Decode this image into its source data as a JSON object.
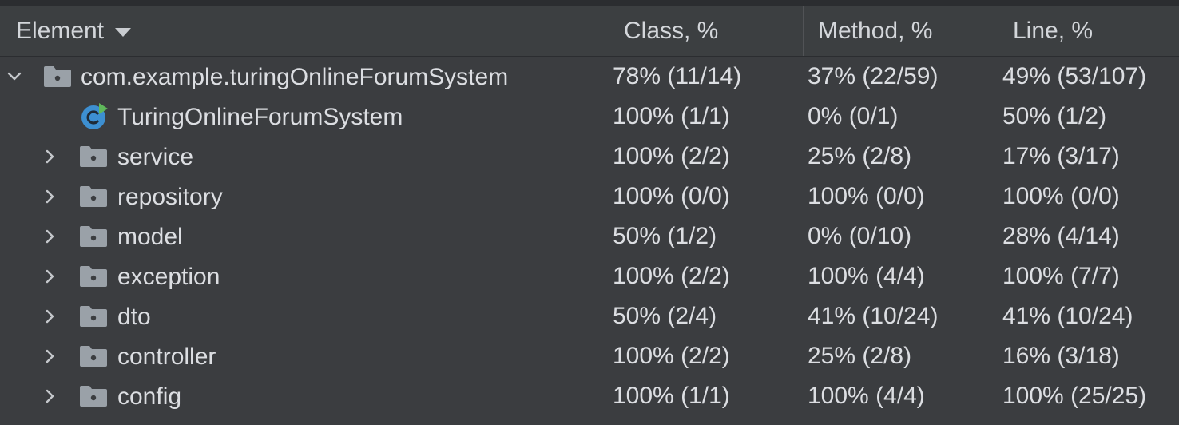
{
  "header": {
    "element": "Element",
    "class": "Class, %",
    "method": "Method, %",
    "line": "Line, %"
  },
  "rows": [
    {
      "name": "com.example.turingOnlineForumSystem",
      "kind": "package",
      "expanded": true,
      "depth": 0,
      "class": "78% (11/14)",
      "method": "37% (22/59)",
      "line": "49% (53/107)"
    },
    {
      "name": "TuringOnlineForumSystem",
      "kind": "class",
      "depth": 1,
      "class": "100% (1/1)",
      "method": "0% (0/1)",
      "line": "50% (1/2)"
    },
    {
      "name": "service",
      "kind": "package",
      "expanded": false,
      "depth": 1,
      "class": "100% (2/2)",
      "method": "25% (2/8)",
      "line": "17% (3/17)"
    },
    {
      "name": "repository",
      "kind": "package",
      "expanded": false,
      "depth": 1,
      "class": "100% (0/0)",
      "method": "100% (0/0)",
      "line": "100% (0/0)"
    },
    {
      "name": "model",
      "kind": "package",
      "expanded": false,
      "depth": 1,
      "class": "50% (1/2)",
      "method": "0% (0/10)",
      "line": "28% (4/14)"
    },
    {
      "name": "exception",
      "kind": "package",
      "expanded": false,
      "depth": 1,
      "class": "100% (2/2)",
      "method": "100% (4/4)",
      "line": "100% (7/7)"
    },
    {
      "name": "dto",
      "kind": "package",
      "expanded": false,
      "depth": 1,
      "class": "50% (2/4)",
      "method": "41% (10/24)",
      "line": "41% (10/24)"
    },
    {
      "name": "controller",
      "kind": "package",
      "expanded": false,
      "depth": 1,
      "class": "100% (2/2)",
      "method": "25% (2/8)",
      "line": "16% (3/18)"
    },
    {
      "name": "config",
      "kind": "package",
      "expanded": false,
      "depth": 1,
      "class": "100% (1/1)",
      "method": "100% (4/4)",
      "line": "100% (25/25)"
    }
  ],
  "icons": {
    "package": "folder-package-icon",
    "class": "spring-boot-class-icon",
    "expanded": "chevron-down-icon",
    "collapsed": "chevron-right-icon",
    "sort": "sort-descending-icon"
  },
  "colors": {
    "background": "#3b3d40",
    "header": "#3c3f41",
    "text": "#dcdee2",
    "folder": "#9aa1a8",
    "class_icon": "#3d8fd1",
    "run_marker": "#5fb85b"
  }
}
